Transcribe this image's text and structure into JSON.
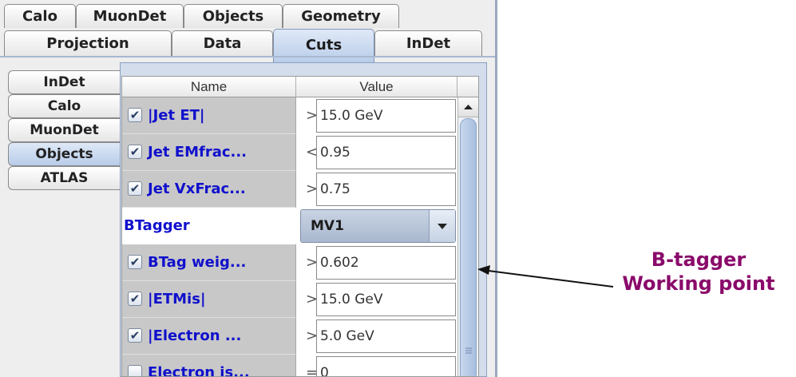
{
  "tabs_row1": [
    "Calo",
    "MuonDet",
    "Objects",
    "Geometry"
  ],
  "tabs_row2": [
    "Projection",
    "Data",
    "Cuts",
    "InDet"
  ],
  "selected_top_tab": "Cuts",
  "side_tabs": [
    "InDet",
    "Calo",
    "MuonDet",
    "Objects",
    "ATLAS"
  ],
  "selected_side_tab": "Objects",
  "table": {
    "headers": {
      "name": "Name",
      "value": "Value"
    },
    "rows": [
      {
        "checked": true,
        "name": "|Jet ET|",
        "op": ">",
        "value": "15.0 GeV"
      },
      {
        "checked": true,
        "name": "Jet EMfrac...",
        "op": "<",
        "value": "0.95"
      },
      {
        "checked": true,
        "name": "Jet VxFrac...",
        "op": ">",
        "value": "0.75"
      },
      {
        "checked": true,
        "name": "BTag weig...",
        "op": ">",
        "value": "0.602"
      },
      {
        "checked": true,
        "name": "|ETMis|",
        "op": ">",
        "value": "15.0 GeV"
      },
      {
        "checked": true,
        "name": "|Electron ...",
        "op": ">",
        "value": "5.0 GeV"
      },
      {
        "checked": false,
        "name": "Electron is...",
        "op": "=",
        "value": "0"
      }
    ],
    "btagger": {
      "label": "BTagger",
      "selected": "MV1"
    }
  },
  "annotation": {
    "line1": "B-tagger",
    "line2": "Working point"
  },
  "colors": {
    "accent_text": "#1010cc",
    "selected_tab": "#b8cde9",
    "annotation": "#8a0a6a"
  },
  "icons": [
    "checkbox-check-icon",
    "dropdown-arrow-icon",
    "scroll-up-arrow-icon",
    "scroll-grip-icon",
    "annotation-arrow-icon"
  ]
}
